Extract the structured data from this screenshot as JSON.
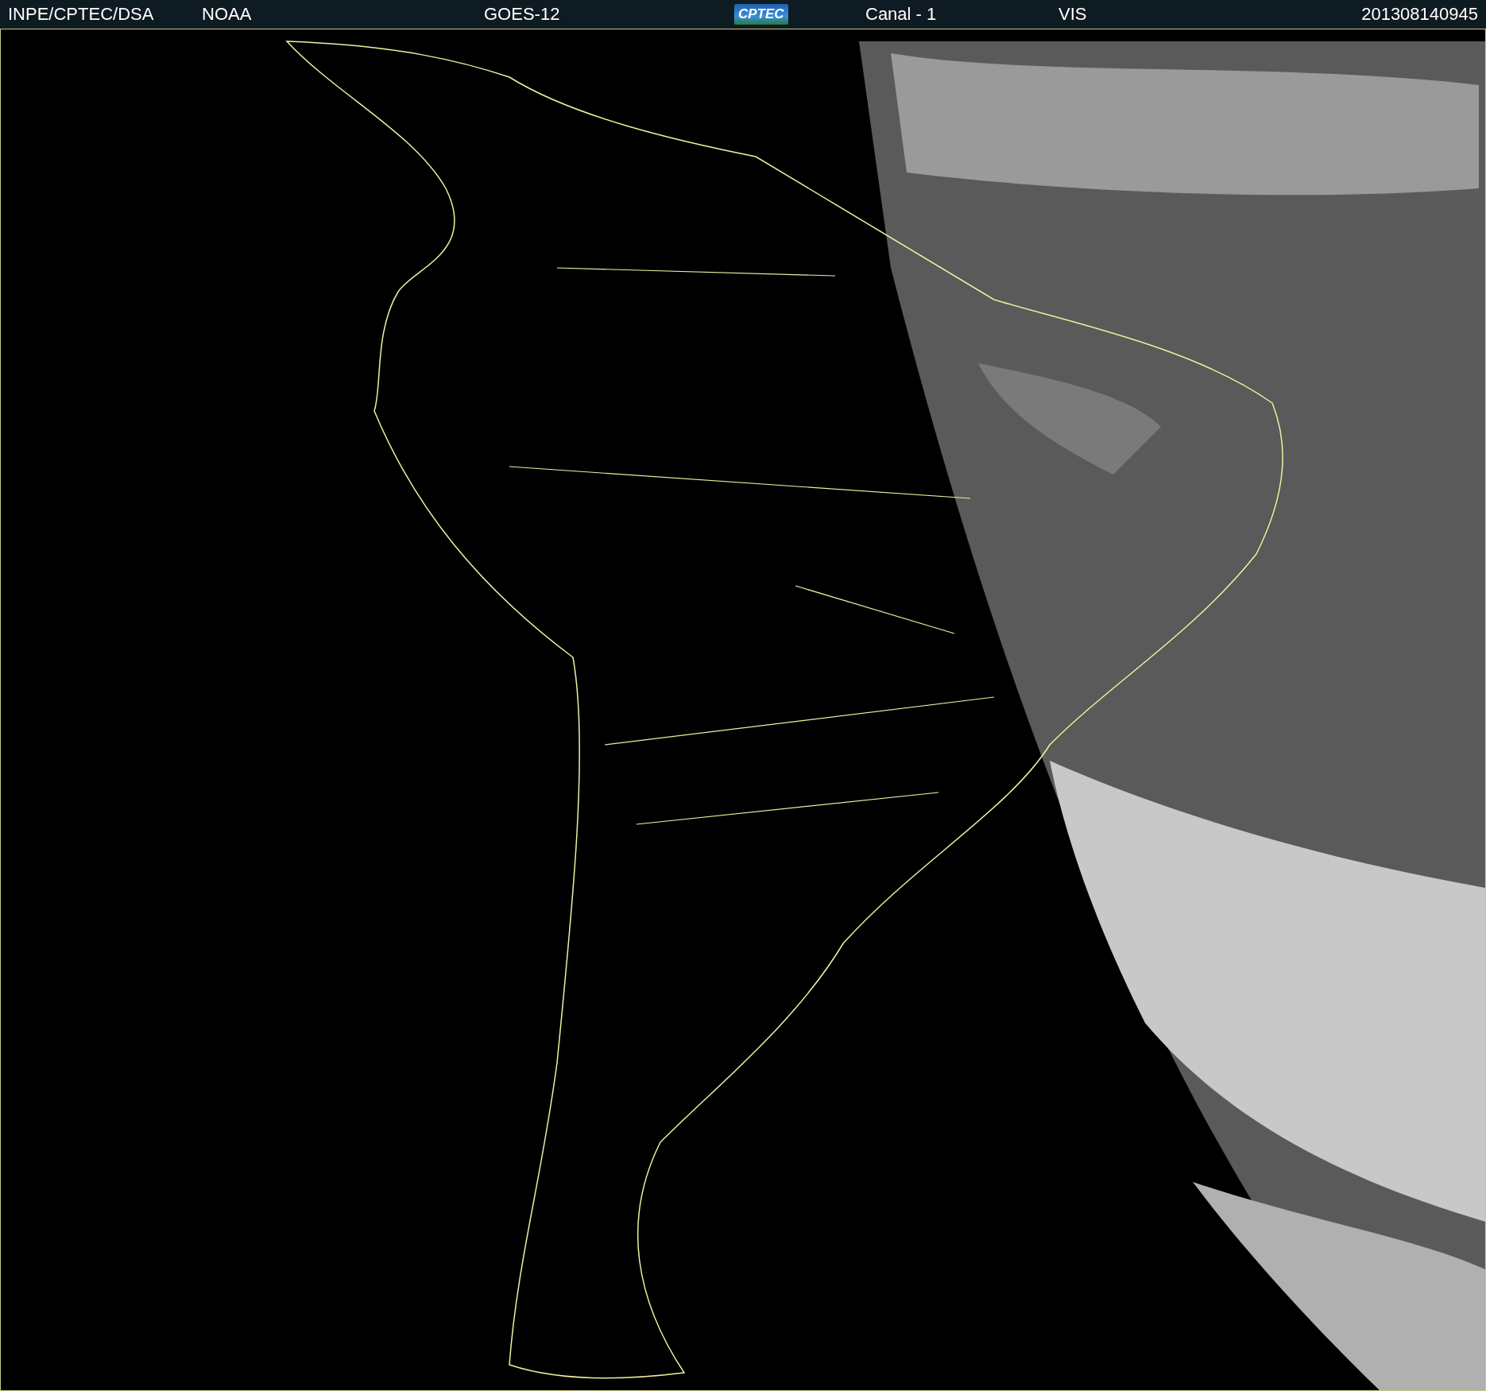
{
  "header": {
    "items": [
      {
        "kind": "text",
        "text": "INPE/CPTEC/DSA"
      },
      {
        "kind": "text",
        "text": "NOAA"
      },
      {
        "kind": "text",
        "text": "GOES-12"
      },
      {
        "kind": "logo",
        "text": "CPTEC"
      },
      {
        "kind": "text",
        "text": "Canal - 1"
      },
      {
        "kind": "text",
        "text": "VIS"
      },
      {
        "kind": "text",
        "text": "201308140945"
      }
    ]
  }
}
